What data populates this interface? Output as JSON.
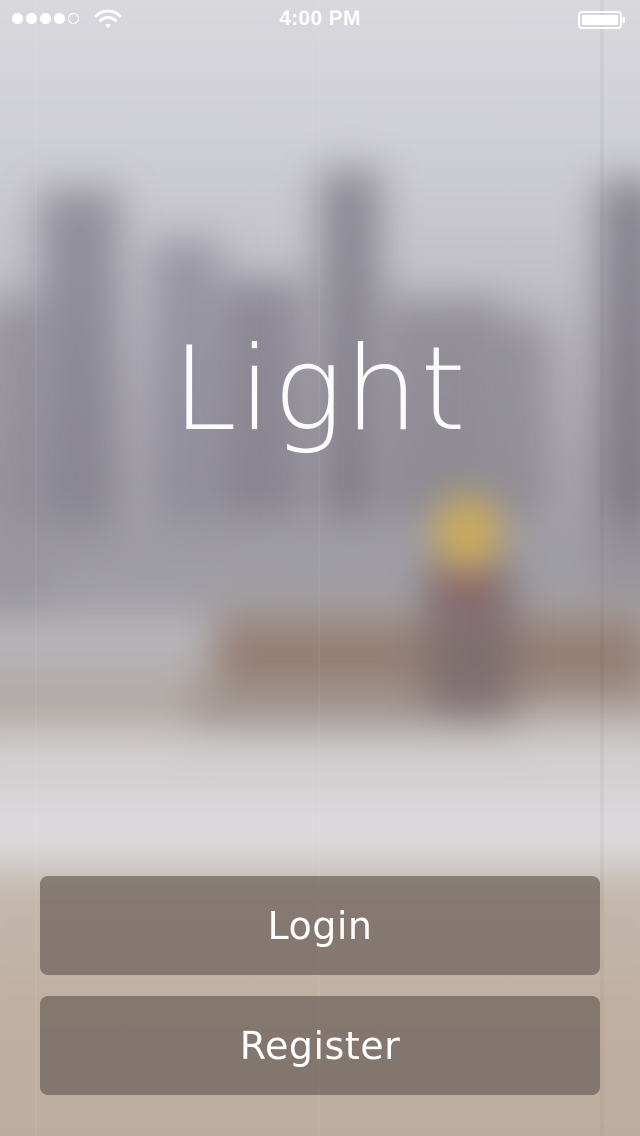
{
  "status_bar": {
    "time": "4:00 PM",
    "signal_dots_filled": 4,
    "signal_dots_total": 5,
    "wifi_icon": "wifi-icon",
    "battery_icon": "battery-full-icon"
  },
  "app": {
    "title": "Light"
  },
  "buttons": {
    "login_label": "Login",
    "register_label": "Register"
  },
  "colors": {
    "button_fill": "#645a54",
    "text": "#ffffff"
  }
}
